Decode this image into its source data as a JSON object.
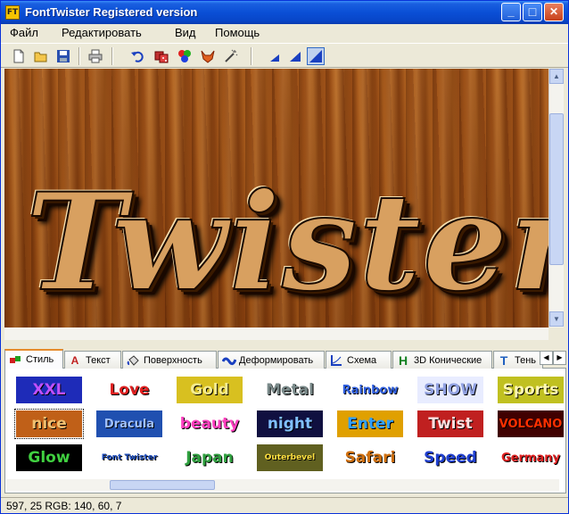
{
  "window": {
    "title": "FontTwister Registered version",
    "app_icon_text": "FT",
    "controls": {
      "minimize": "_",
      "maximize": "□",
      "close": "✕"
    }
  },
  "menu": [
    "Файл",
    "Редактировать",
    "Вид",
    "Помощь"
  ],
  "toolbar": {
    "tools": [
      "new-file-icon",
      "open-folder-icon",
      "save-icon",
      "print-icon",
      "undo-icon",
      "dice-icon",
      "color-balls-icon",
      "fox-icon",
      "magic-wand-icon",
      "small-triangle-icon",
      "medium-triangle-icon",
      "large-triangle-icon"
    ],
    "pressed_tool": "large-triangle-icon"
  },
  "preview": {
    "text": "Twister",
    "colors": {
      "wood": "#9a4e16",
      "letter_face": "#d8a060",
      "outline": "#1a0a00"
    }
  },
  "tabs": [
    {
      "label": "Стиль",
      "icon": "cubes-icon",
      "active": true
    },
    {
      "label": "Текст",
      "icon": "letter-a-icon"
    },
    {
      "label": "Поверхность",
      "icon": "paint-bucket-icon"
    },
    {
      "label": "Деформировать",
      "icon": "wave-icon"
    },
    {
      "label": "Схема",
      "icon": "curve-icon"
    },
    {
      "label": "3D Конические",
      "icon": "h-3d-icon"
    },
    {
      "label": "Тень",
      "icon": "t-shadow-icon"
    }
  ],
  "styles": [
    {
      "label": "XXL",
      "bg": "#1e2bb8",
      "fg": "#c050ff"
    },
    {
      "label": "Love",
      "bg": "#ffffff",
      "fg": "#e02020"
    },
    {
      "label": "Gold",
      "bg": "#d8c020",
      "fg": "#f6ec90"
    },
    {
      "label": "Metal",
      "bg": "#ffffff",
      "fg": "#7a8a8a"
    },
    {
      "label": "Rainbow",
      "bg": "#ffffff",
      "fg": "#3060e0"
    },
    {
      "label": "SHOW",
      "bg": "#e8ecff",
      "fg": "#90a0e0"
    },
    {
      "label": "Sports",
      "bg": "#c0c020",
      "fg": "#fff8b0"
    },
    {
      "label": "nice",
      "bg": "#c06018",
      "fg": "#f0c070",
      "selected": true
    },
    {
      "label": "Dracula",
      "bg": "#2050b0",
      "fg": "#a0c0ff"
    },
    {
      "label": "beauty",
      "bg": "#ffffff",
      "fg": "#ff40c0"
    },
    {
      "label": "night",
      "bg": "#101040",
      "fg": "#80c0ff"
    },
    {
      "label": "Enter",
      "bg": "#e0a000",
      "fg": "#30a0ff"
    },
    {
      "label": "Twist",
      "bg": "#c02020",
      "fg": "#ffe0e0"
    },
    {
      "label": "VOLCANO",
      "bg": "#400000",
      "fg": "#ff3000"
    },
    {
      "label": "Glow",
      "bg": "#000000",
      "fg": "#40d040"
    },
    {
      "label": "Font Twister",
      "bg": "#ffffff",
      "fg": "#2050c0"
    },
    {
      "label": "Japan",
      "bg": "#ffffff",
      "fg": "#30a040"
    },
    {
      "label": "Outerbevel",
      "bg": "#606020",
      "fg": "#ffe040"
    },
    {
      "label": "Safari",
      "bg": "#ffffff",
      "fg": "#d07010"
    },
    {
      "label": "Speed",
      "bg": "#ffffff",
      "fg": "#2040d0"
    },
    {
      "label": "Germany",
      "bg": "#ffffff",
      "fg": "#e02020"
    }
  ],
  "status": "597, 25 RGB: 140, 60, 7"
}
